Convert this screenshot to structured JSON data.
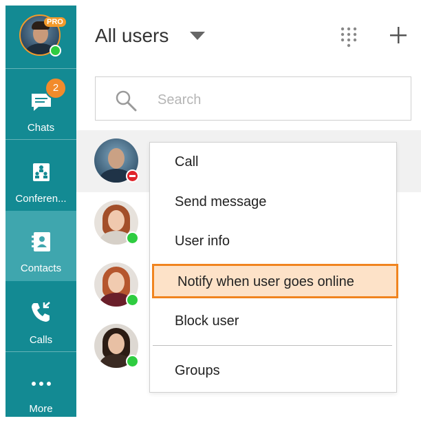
{
  "sidebar": {
    "profile": {
      "pro_badge": "PRO",
      "status": "online"
    },
    "items": [
      {
        "id": "chats",
        "label": "Chats",
        "icon": "chat-bubble-icon",
        "badge": "2"
      },
      {
        "id": "conferences",
        "label": "Conferen...",
        "icon": "conference-icon"
      },
      {
        "id": "contacts",
        "label": "Contacts",
        "icon": "contacts-book-icon",
        "active": true
      },
      {
        "id": "calls",
        "label": "Calls",
        "icon": "phone-calls-icon"
      },
      {
        "id": "more",
        "label": "More",
        "icon": "more-dots-icon"
      }
    ]
  },
  "header": {
    "title": "All users"
  },
  "search": {
    "placeholder": "Search",
    "value": ""
  },
  "contacts": [
    {
      "status": "do-not-disturb"
    },
    {
      "status": "online"
    },
    {
      "status": "online"
    },
    {
      "status": "online"
    }
  ],
  "context_menu": {
    "items": [
      {
        "label": "Call"
      },
      {
        "label": "Send message"
      },
      {
        "label": "User info"
      },
      {
        "label": "Notify when user goes online",
        "highlighted": true
      },
      {
        "label": "Block user"
      },
      {
        "label": "Groups"
      }
    ]
  },
  "colors": {
    "sidebar": "#138a93",
    "sidebar_active": "#3fa6ae",
    "accent_orange": "#f0841f",
    "highlight_fill": "#fde2c8",
    "online": "#2ecc40",
    "dnd": "#e0252b"
  }
}
